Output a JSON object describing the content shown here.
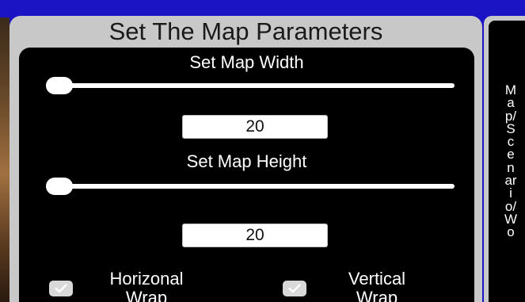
{
  "panel": {
    "title": "Set The Map Parameters",
    "width": {
      "label": "Set Map Width",
      "value": "20",
      "slider_fraction": 0.0
    },
    "height": {
      "label": "Set Map Height",
      "value": "20",
      "slider_fraction": 0.0
    },
    "horizontal_wrap": {
      "label_line1": "Horizonal",
      "label_line2": "Wrap",
      "checked": true
    },
    "vertical_wrap": {
      "label_line1": "Vertical",
      "label_line2": "Wrap",
      "checked": true
    }
  },
  "side_tab": {
    "label": "Map/Scenario/Wo"
  },
  "colors": {
    "background": "#1a14c4",
    "panel_frame": "#c8c8c8",
    "panel_body": "#000000",
    "text": "#ffffff"
  }
}
